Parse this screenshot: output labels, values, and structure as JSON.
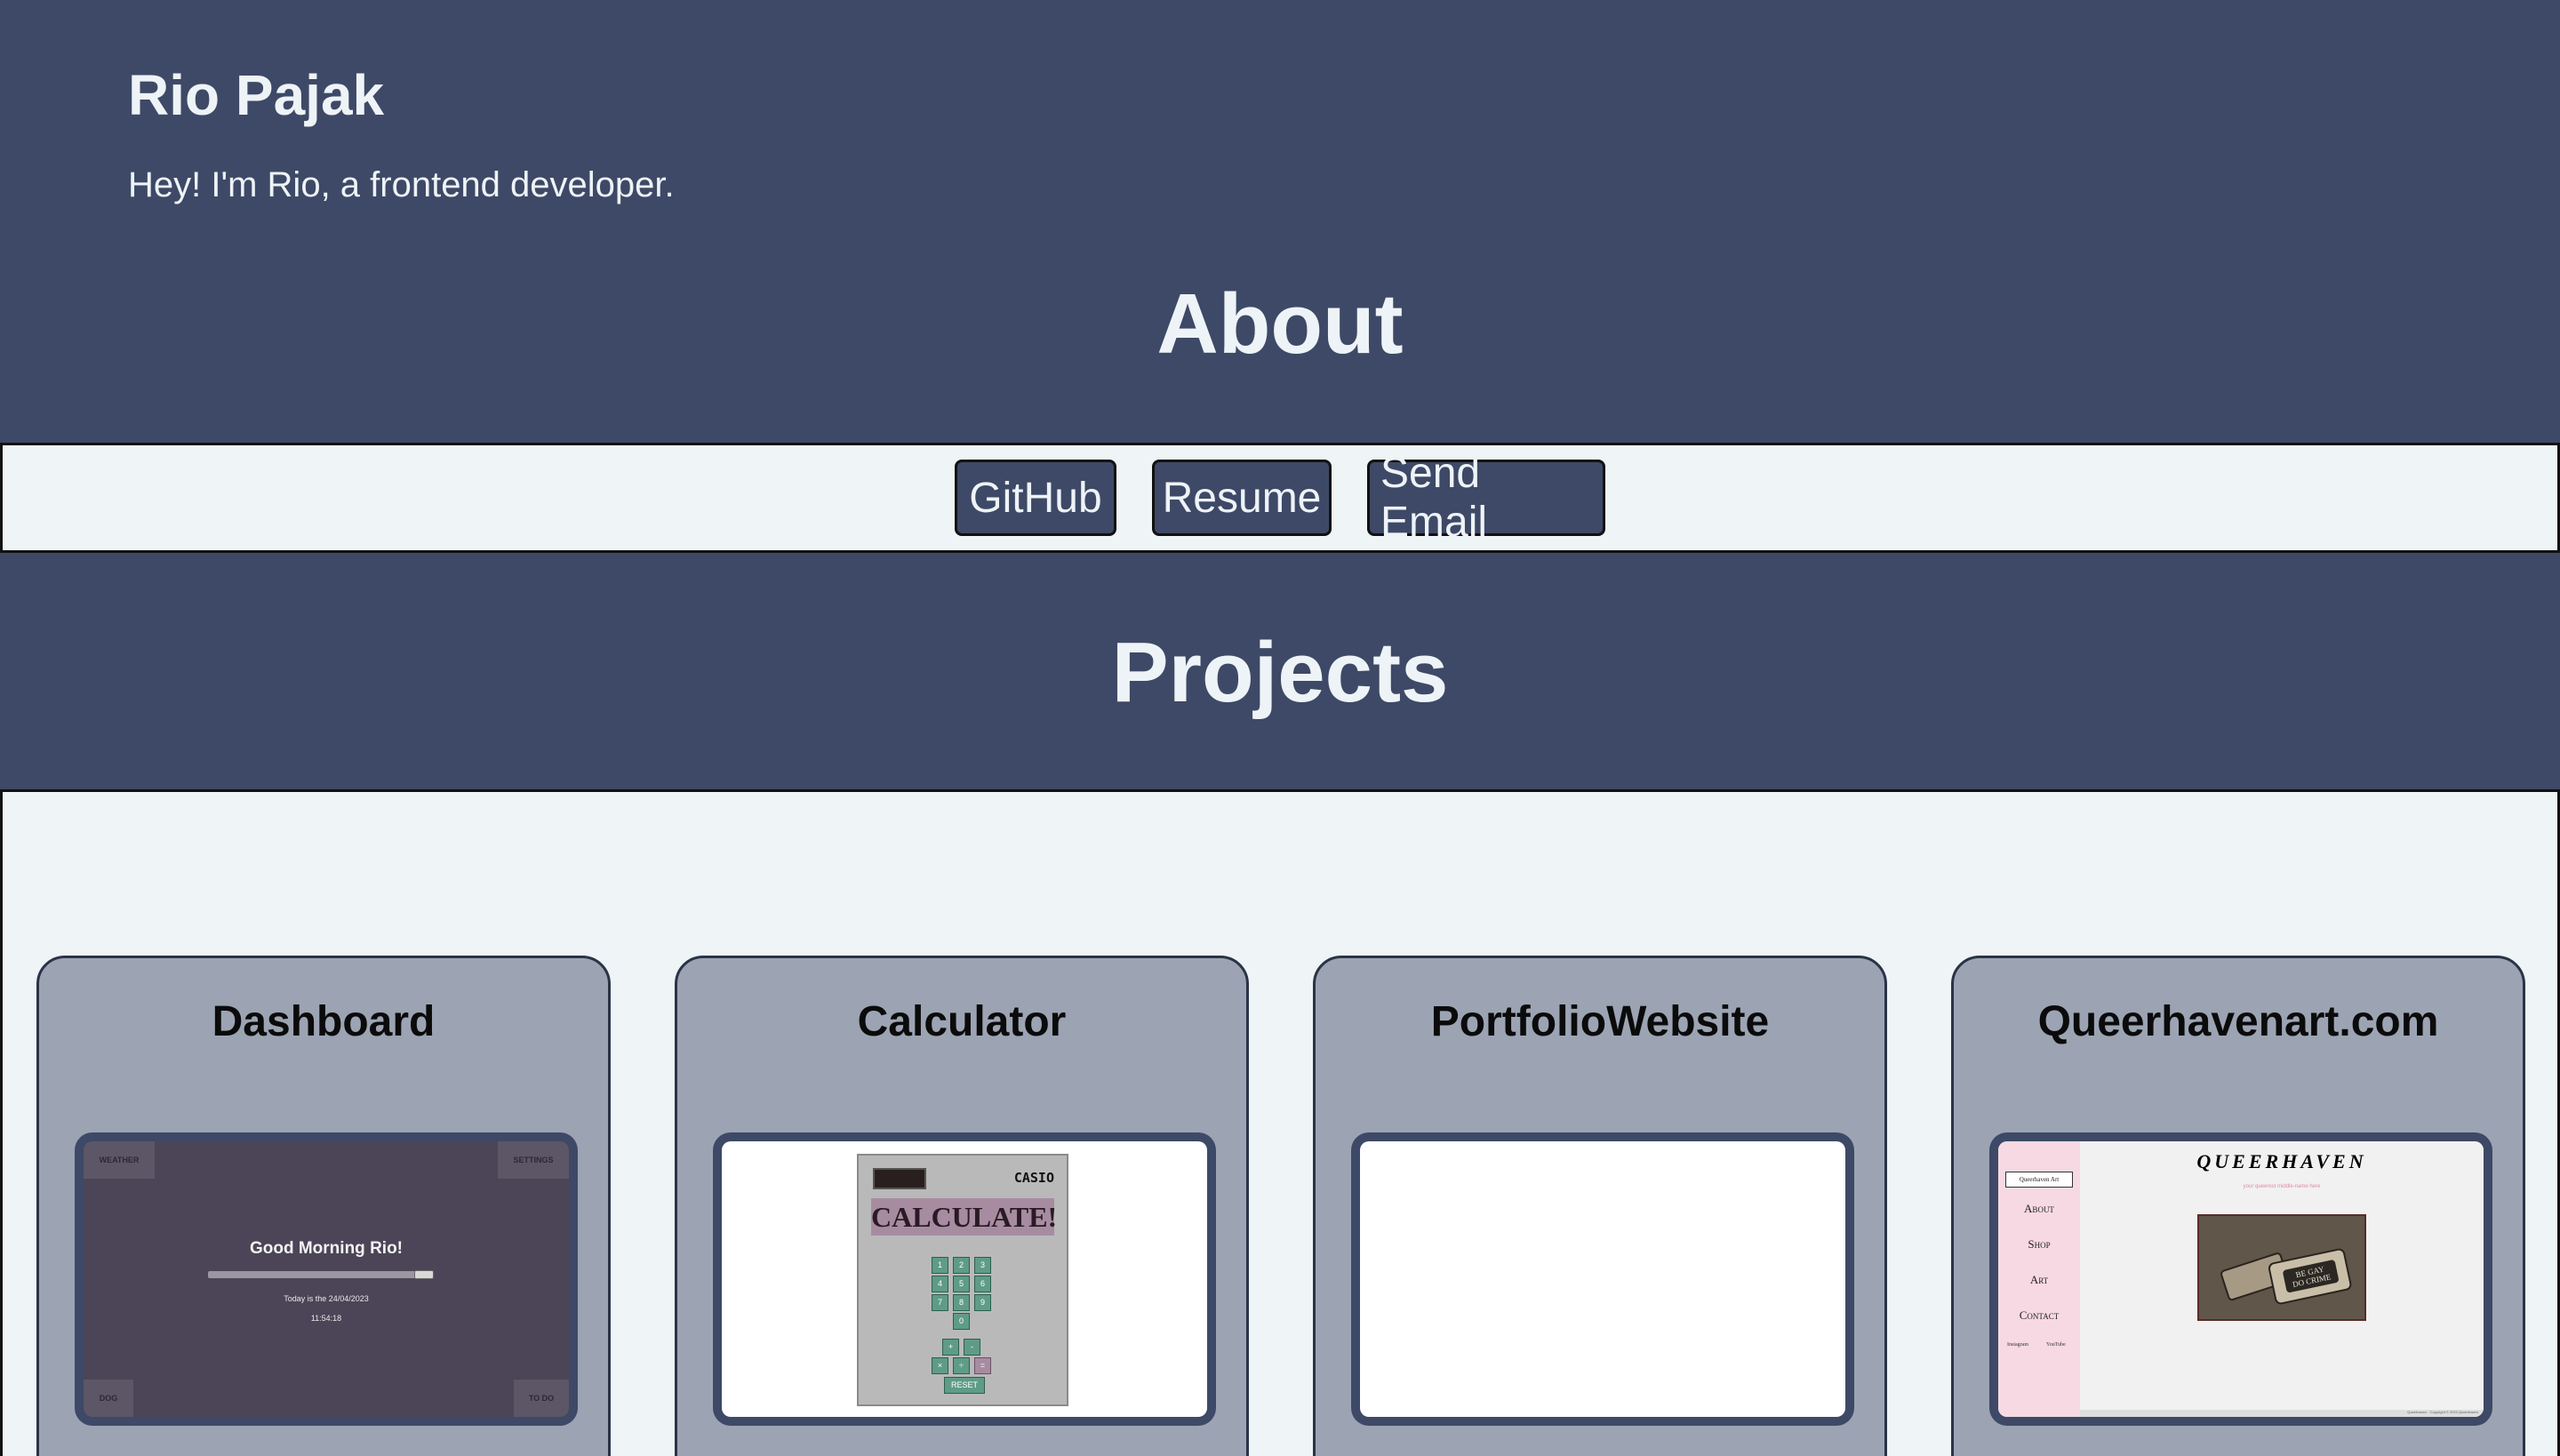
{
  "header": {
    "name": "Rio Pajak",
    "tagline": "Hey! I'm Rio, a frontend developer."
  },
  "about": {
    "title": "About",
    "links": [
      {
        "label": "GitHub"
      },
      {
        "label": "Resume"
      },
      {
        "label": "Send Email"
      }
    ]
  },
  "projects": {
    "title": "Projects",
    "cards": [
      {
        "title": "Dashboard",
        "preview": {
          "weather": "WEATHER",
          "settings": "SETTINGS",
          "dog": "DOG",
          "todo": "TO DO",
          "greeting": "Good Morning Rio!",
          "date": "Today is the 24/04/2023",
          "time": "11:54:18"
        }
      },
      {
        "title": "Calculator",
        "preview": {
          "brand": "CASIO",
          "heading": "CALCULATE!",
          "keys": [
            "1",
            "2",
            "3",
            "4",
            "5",
            "6",
            "7",
            "8",
            "9",
            "0",
            "+",
            "-",
            "×",
            "÷",
            "=",
            "÷"
          ],
          "reset": "RESET"
        }
      },
      {
        "title": "PortfolioWebsite",
        "preview": {}
      },
      {
        "title": "Queerhavenart.com",
        "preview": {
          "logo": "Queerhaven Art",
          "nav": [
            "About",
            "Shop",
            "Art",
            "Contact"
          ],
          "social": [
            "Instagram",
            "YouTube"
          ],
          "site_title": "QUEERHAVEN",
          "tagline": "your queerest middle-name here",
          "footer": "Queerhaven · Copyright © 2023 Queerhaven"
        }
      }
    ]
  },
  "colors": {
    "page_bg": "#3d4966",
    "panel_bg": "#eff4f7",
    "card_bg": "#9ca4b4",
    "text_light": "#eef3f7"
  }
}
